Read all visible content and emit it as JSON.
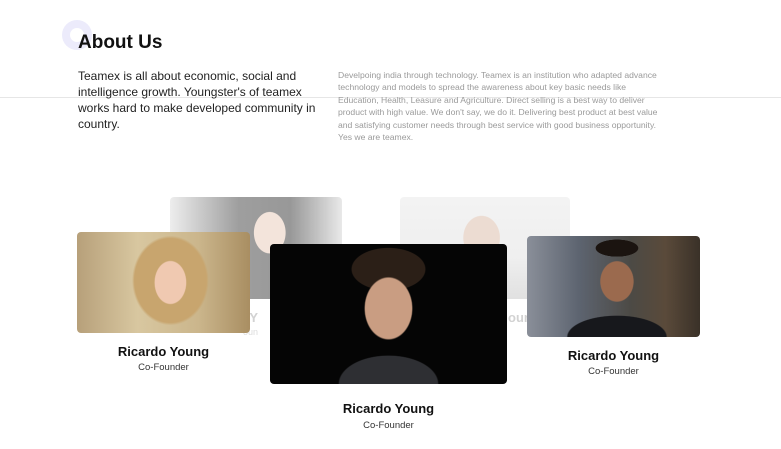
{
  "about": {
    "title": "About Us",
    "lead": "Teamex is all about economic, social and intelligence growth. Youngster's of teamex works hard to make developed community in country.",
    "description": "Develpoing india through technology. Teamex is an institution who adapted advance technology and models to spread the awareness about key basic needs like Education, Health, Leasure and Agriculture. Direct selling is a best way to deliver product with high value. We don't say, we do it. Delivering best product at best value and satisfying customer needs through best service with good business opportunity. Yes we are teamex."
  },
  "team": {
    "members": [
      {
        "name": "Ricardo Young",
        "role": "Co-Founder"
      },
      {
        "name": "Ricardo Young",
        "role": "Co-Founder"
      },
      {
        "name": "Ricardo Young",
        "role": "Co-Founder"
      }
    ],
    "ghost_fragments": [
      {
        "name": "o Y",
        "role": "oun"
      },
      {
        "name": "oun",
        "role": "oun"
      }
    ]
  }
}
